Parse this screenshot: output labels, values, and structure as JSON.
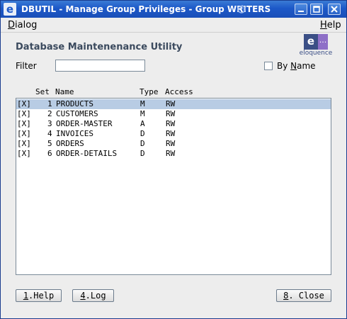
{
  "window": {
    "title": "DBUTIL - Manage Group Privileges - Group WRITERS",
    "app_icon": "e"
  },
  "menubar": {
    "dialog": "Dialog",
    "help": "Help"
  },
  "header": {
    "title": "Database Maintenenance Utility"
  },
  "logo": {
    "mark": "e",
    "dots": "...",
    "text": "eloquence"
  },
  "filter": {
    "label": "Filter",
    "value": ""
  },
  "by_name": {
    "label": "By Name",
    "checked": false
  },
  "columns": {
    "set": "Set",
    "name": "Name",
    "type": "Type",
    "access": "Access"
  },
  "rows": [
    {
      "mark": "[X]",
      "set": "1",
      "name": "PRODUCTS",
      "type": "M",
      "access": "RW"
    },
    {
      "mark": "[X]",
      "set": "2",
      "name": "CUSTOMERS",
      "type": "M",
      "access": "RW"
    },
    {
      "mark": "[X]",
      "set": "3",
      "name": "ORDER-MASTER",
      "type": "A",
      "access": "RW"
    },
    {
      "mark": "[X]",
      "set": "4",
      "name": "INVOICES",
      "type": "D",
      "access": "RW"
    },
    {
      "mark": "[X]",
      "set": "5",
      "name": "ORDERS",
      "type": "D",
      "access": "RW"
    },
    {
      "mark": "[X]",
      "set": "6",
      "name": "ORDER-DETAILS",
      "type": "D",
      "access": "RW"
    }
  ],
  "buttons": {
    "help": "1.Help",
    "log": "4.Log",
    "close": "8. Close"
  },
  "colors": {
    "titlebar": "#1c58c8",
    "selection": "#b8cce4",
    "heading": "#3b4a5e"
  }
}
